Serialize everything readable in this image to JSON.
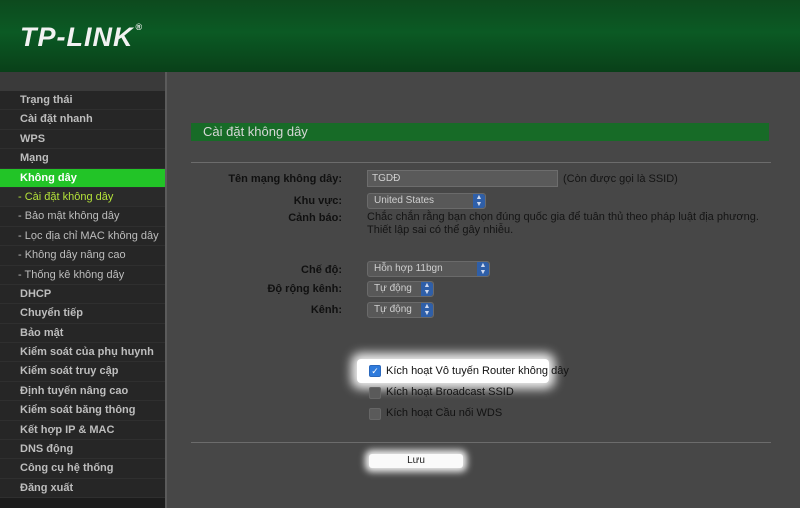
{
  "header": {
    "logo": "TP-LINK",
    "logo_mark": "®"
  },
  "sidebar": {
    "items": [
      {
        "label": "Trạng thái",
        "state": "normal"
      },
      {
        "label": "Cài đặt nhanh",
        "state": "normal"
      },
      {
        "label": "WPS",
        "state": "normal"
      },
      {
        "label": "Mạng",
        "state": "normal"
      },
      {
        "label": "Không dây",
        "state": "active-parent"
      },
      {
        "label": "- Cài đặt không dây",
        "state": "active-child"
      },
      {
        "label": "- Bảo mật không dây",
        "state": "sub"
      },
      {
        "label": "- Lọc địa chỉ MAC không dây",
        "state": "sub"
      },
      {
        "label": "- Không dây nâng cao",
        "state": "sub"
      },
      {
        "label": "- Thống kê không dây",
        "state": "sub"
      },
      {
        "label": "DHCP",
        "state": "normal"
      },
      {
        "label": "Chuyển tiếp",
        "state": "normal"
      },
      {
        "label": "Bảo mật",
        "state": "normal"
      },
      {
        "label": "Kiểm soát của phụ huynh",
        "state": "normal"
      },
      {
        "label": "Kiểm soát truy cập",
        "state": "normal"
      },
      {
        "label": "Định tuyến nâng cao",
        "state": "normal"
      },
      {
        "label": "Kiểm soát băng thông",
        "state": "normal"
      },
      {
        "label": "Kết hợp IP & MAC",
        "state": "normal"
      },
      {
        "label": "DNS động",
        "state": "normal"
      },
      {
        "label": "Công cụ hệ thống",
        "state": "normal"
      },
      {
        "label": "Đăng xuất",
        "state": "normal"
      }
    ]
  },
  "main": {
    "section_title": "Cài đặt không dây",
    "ssid_label": "Tên mạng không dây:",
    "ssid_value": "TGDĐ",
    "ssid_note": "(Còn được gọi là SSID)",
    "region_label": "Khu vực:",
    "region_value": "United States",
    "warning_label": "Cảnh báo:",
    "warning_line1": "Chắc chắn rằng bạn chọn đúng quốc gia để tuân thủ theo pháp luật địa phương.",
    "warning_line2": "Thiết lập sai có thể gây nhiễu.",
    "mode_label": "Chế độ:",
    "mode_value": "Hỗn hợp 11bgn",
    "width_label": "Độ rộng kênh:",
    "width_value": "Tự động",
    "channel_label": "Kênh:",
    "channel_value": "Tự động",
    "enable_radio_label": "Kích hoạt Vô tuyến Router không dây",
    "enable_radio_checked": true,
    "broadcast_label": "Kích hoạt Broadcast SSID",
    "broadcast_checked": false,
    "wds_label": "Kích hoạt Cầu nối WDS",
    "wds_checked": false,
    "save_label": "Lưu"
  },
  "colors": {
    "active_nav": "#22c427",
    "section_bar": "#176b27",
    "checkbox": "#2f7bdc"
  }
}
